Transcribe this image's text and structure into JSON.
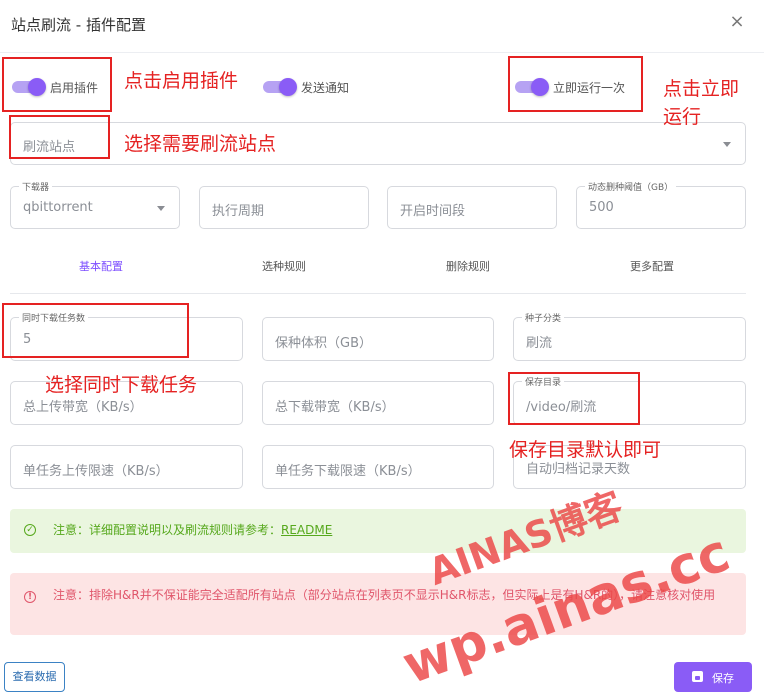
{
  "dialog": {
    "title": "站点刷流 - 插件配置",
    "close_icon": "×"
  },
  "switches": {
    "enable": {
      "label": "启用插件",
      "on": true
    },
    "notify": {
      "label": "发送通知",
      "on": true
    },
    "run_once": {
      "label": "立即运行一次",
      "on": true
    }
  },
  "fields": {
    "sites": {
      "placeholder": "刷流站点"
    },
    "downloader": {
      "label": "下载器",
      "value": "qbittorrent"
    },
    "cron": {
      "placeholder": "执行周期"
    },
    "time_range": {
      "placeholder": "开启时间段"
    },
    "delete_threshold": {
      "label": "动态删种阈值（GB）",
      "value": "500"
    },
    "max_tasks": {
      "label": "同时下载任务数",
      "value": "5"
    },
    "seed_size": {
      "placeholder": "保种体积（GB）"
    },
    "category": {
      "label": "种子分类",
      "value": "刷流"
    },
    "total_up": {
      "placeholder": "总上传带宽（KB/s）"
    },
    "total_down": {
      "placeholder": "总下载带宽（KB/s）"
    },
    "save_path": {
      "label": "保存目录",
      "value": "/video/刷流"
    },
    "task_up": {
      "placeholder": "单任务上传限速（KB/s）"
    },
    "task_down": {
      "placeholder": "单任务下载限速（KB/s）"
    },
    "archive_days": {
      "placeholder": "自动归档记录天数"
    }
  },
  "tabs": [
    {
      "label": "基本配置",
      "active": true
    },
    {
      "label": "选种规则"
    },
    {
      "label": "删除规则"
    },
    {
      "label": "更多配置"
    }
  ],
  "alerts": {
    "info_prefix": "注意：详细配置说明以及刷流规则请参考：",
    "info_link": "README",
    "warning": "注意：排除H&R并不保证能完全适配所有站点（部分站点在列表页不显示H&R标志，但实际上是有H&R的），请注意核对使用"
  },
  "buttons": {
    "view_data": "查看数据",
    "save": "保存"
  },
  "annotations": {
    "enable": "点击启用插件",
    "run_once_1": "点击立即",
    "run_once_2": "运行",
    "sites": "选择需要刷流站点",
    "tasks": "选择同时下载任务",
    "save_path": "保存目录默认即可"
  },
  "watermark": {
    "line1": "AINAS博客",
    "line2": "wp.ainas.cc"
  },
  "colors": {
    "accent": "#8a5cf6",
    "annotation": "#e52222",
    "success": "#56a81c",
    "error": "#e0556a"
  }
}
